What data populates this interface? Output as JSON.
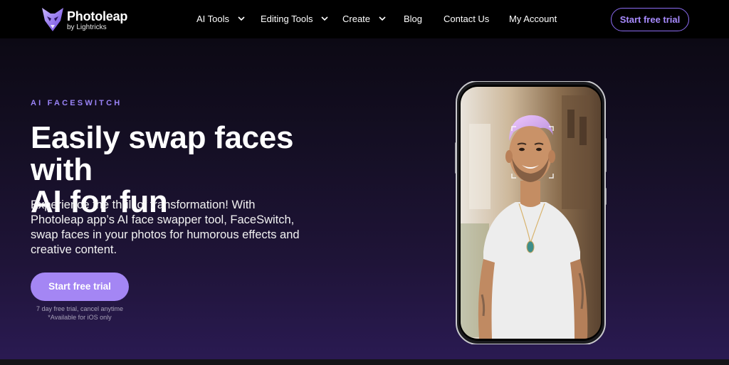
{
  "brand": {
    "name": "Photoleap",
    "subtitle": "by Lightricks"
  },
  "nav": {
    "items": [
      {
        "label": "AI Tools",
        "dropdown": true
      },
      {
        "label": "Editing Tools",
        "dropdown": true
      },
      {
        "label": "Create",
        "dropdown": true
      },
      {
        "label": "Blog",
        "dropdown": false
      },
      {
        "label": "Contact Us",
        "dropdown": false
      },
      {
        "label": "My Account",
        "dropdown": false
      }
    ],
    "cta_label": "Start free trial"
  },
  "hero": {
    "eyebrow": "AI FACESWITCH",
    "headline_line1": "Easily swap faces with",
    "headline_line2": "AI for fun",
    "description": "Experience the thrill of transformation! With Photoleap app’s AI face swapper tool, FaceSwitch, swap faces in your photos for humorous effects and creative content.",
    "cta_label": "Start free trial",
    "trial_note": "7 day free trial, cancel anytime",
    "platform_note": "*Available for iOS only"
  },
  "colors": {
    "accent": "#a486f4",
    "accent_text": "#9a83f7",
    "header_bg": "#000000",
    "hero_bg_top": "#0c0914",
    "hero_bg_bottom": "#2a1a52"
  },
  "icons": {
    "logo": "photoleap-fox-logo",
    "nav_dropdown": "chevron-down-icon",
    "face_scan": "face-detection-frame"
  }
}
